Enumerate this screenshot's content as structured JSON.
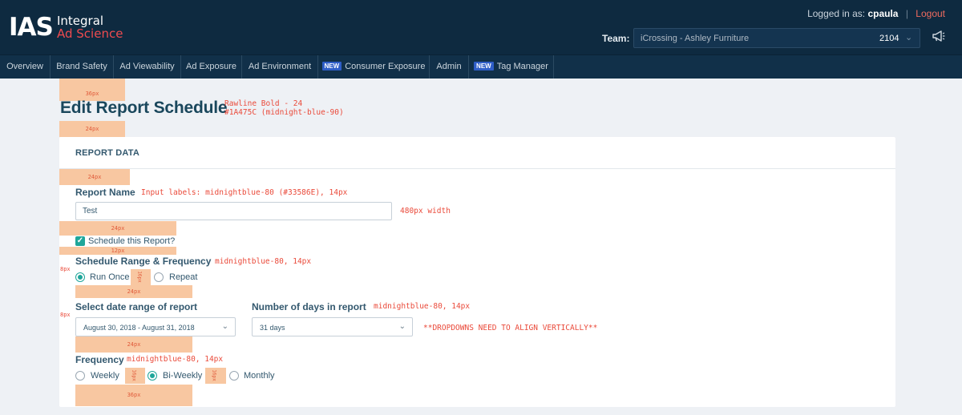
{
  "header": {
    "logo_main": "IAS",
    "logo_line1": "Integral",
    "logo_line2": "Ad Science",
    "logged_in_prefix": "Logged in as:",
    "username": "cpaula",
    "separator": "|",
    "logout": "Logout",
    "team_label": "Team:",
    "team_name": "iCrossing - Ashley Furniture",
    "team_number": "2104",
    "team_chevron_icon": "chevron-down-icon",
    "notifications_icon": "megaphone-icon"
  },
  "nav": {
    "items": [
      {
        "label": "Overview",
        "badge": ""
      },
      {
        "label": "Brand Safety",
        "badge": ""
      },
      {
        "label": "Ad Viewability",
        "badge": ""
      },
      {
        "label": "Ad Exposure",
        "badge": ""
      },
      {
        "label": "Ad Environment",
        "badge": ""
      },
      {
        "label": "Consumer Exposure",
        "badge": "NEW"
      },
      {
        "label": "Admin",
        "badge": ""
      },
      {
        "label": "Tag Manager",
        "badge": "NEW"
      }
    ]
  },
  "page": {
    "title": "Edit Report Schedule"
  },
  "form": {
    "section_header": "REPORT DATA",
    "report_name_label": "Report Name",
    "report_name_value": "Test",
    "schedule_checkbox_label": "Schedule this Report?",
    "schedule_checked": true,
    "range_label": "Schedule Range & Frequency",
    "range_options": [
      {
        "label": "Run Once",
        "selected": true
      },
      {
        "label": "Repeat",
        "selected": false
      }
    ],
    "date_range_label": "Select date range of report",
    "date_range_value": "August 30, 2018 - August 31, 2018",
    "days_label": "Number of days in report",
    "days_value": "31 days",
    "frequency_label": "Frequency",
    "frequency_options": [
      {
        "label": "Weekly",
        "selected": false
      },
      {
        "label": "Bi-Weekly",
        "selected": true
      },
      {
        "label": "Monthly",
        "selected": false
      }
    ]
  },
  "annotations": {
    "sp_36a": "36px",
    "sp_24a": "24px",
    "sp_24b": "24px",
    "sp_24c": "24px",
    "sp_12": "12px",
    "sp_24d": "24px",
    "sp_24e": "24px",
    "sp_36b": "36px",
    "side_8a": "8px",
    "side_8b": "8px",
    "vert_a": "16px",
    "vert_b": "16px",
    "vert_c": "16px",
    "title_font": "Rawline Bold - 24",
    "title_color": "#1A475C (midnight-blue-90)",
    "input_labels": "Input labels: midnightblue-80 (#33586E), 14px",
    "width_note": "480px width",
    "range_note": "midnightblue-80, 14px",
    "days_note": "midnightblue-80, 14px",
    "dropdown_note": "**DROPDOWNS NEED TO ALIGN VERTICALLY**",
    "freq_note": "midnightblue-80, 14px"
  },
  "colors": {
    "header_bg": "#0e2a40",
    "brand_red": "#ef4b4f",
    "title": "#1a475c",
    "label": "#33586e",
    "accent_teal": "#1fa69a",
    "annotation_red": "#ea4a3a",
    "spacer_peach": "#f8c7a1"
  }
}
